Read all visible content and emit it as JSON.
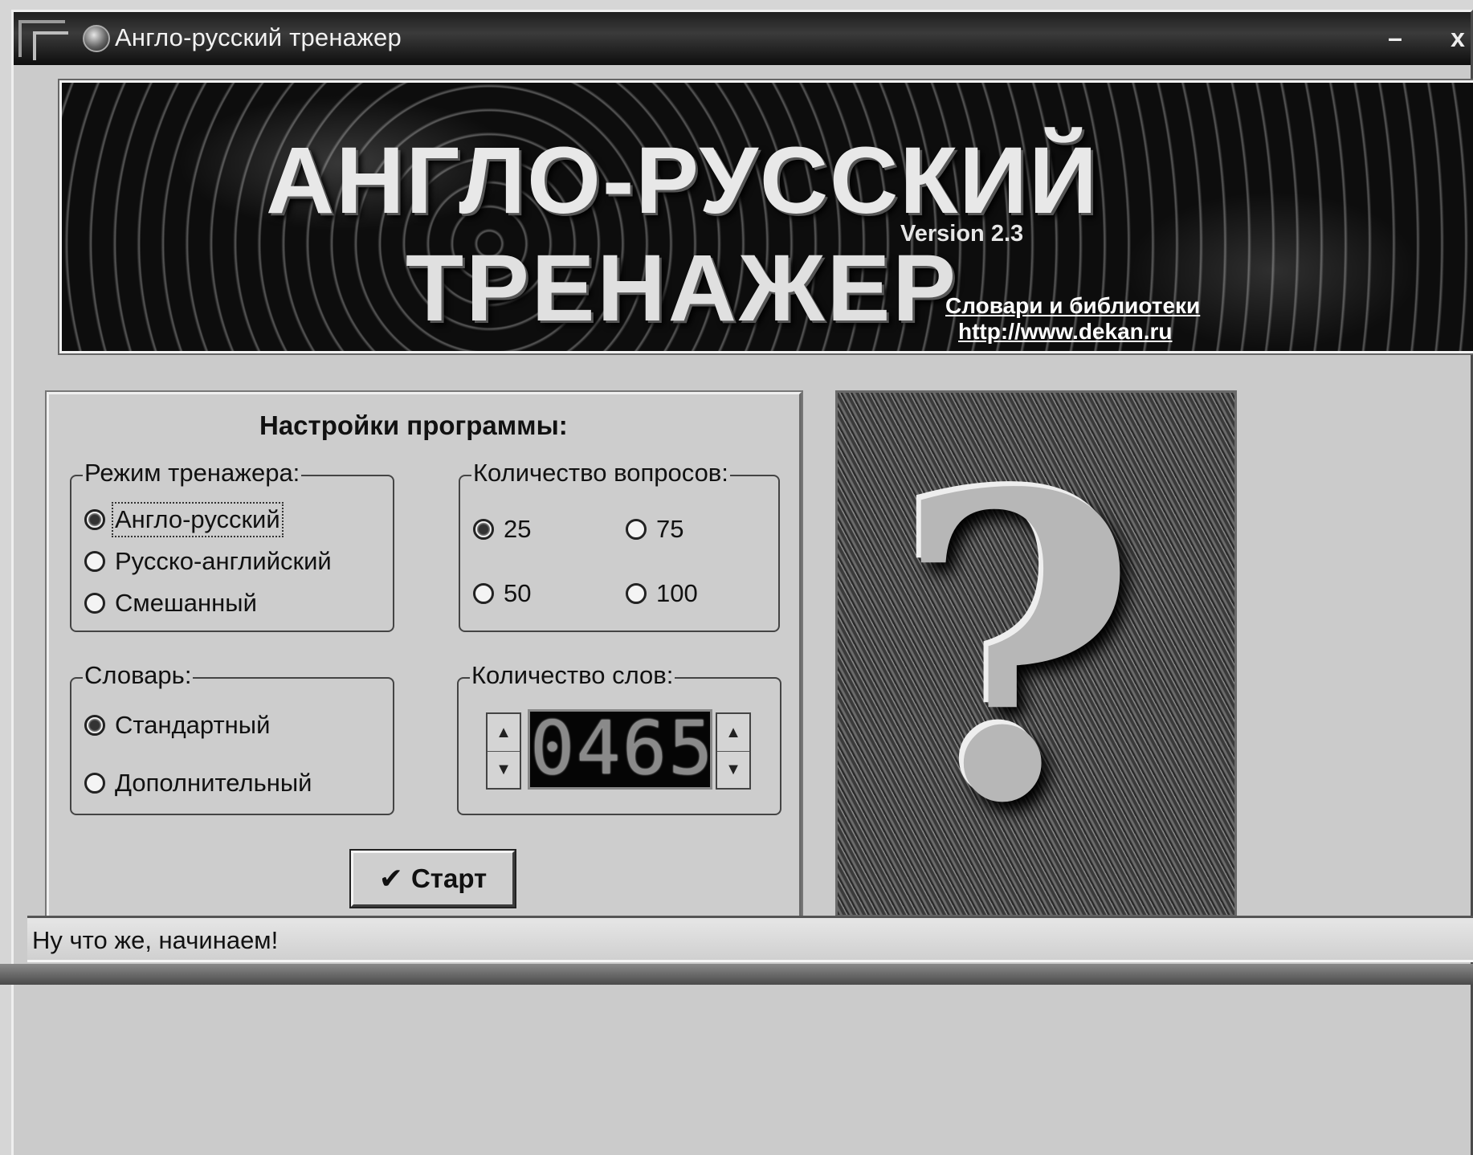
{
  "window": {
    "title": "Англо-русский тренажер",
    "minimize_label": "–",
    "close_label": "x"
  },
  "banner": {
    "line1": "АНГЛО-РУССКИЙ",
    "line2": "ТРЕНАЖЕР",
    "version": "Version 2.3",
    "link_text": "Словари и библиотеки",
    "link_url": "http://www.dekan.ru"
  },
  "settings": {
    "title": "Настройки программы:",
    "mode": {
      "caption": "Режим тренажера:",
      "options": [
        {
          "label": "Англо-русский",
          "selected": true
        },
        {
          "label": "Русско-английский",
          "selected": false
        },
        {
          "label": "Смешанный",
          "selected": false
        }
      ]
    },
    "questions": {
      "caption": "Количество вопросов:",
      "options": [
        {
          "label": "25",
          "selected": true
        },
        {
          "label": "75",
          "selected": false
        },
        {
          "label": "50",
          "selected": false
        },
        {
          "label": "100",
          "selected": false
        }
      ]
    },
    "dictionary": {
      "caption": "Словарь:",
      "options": [
        {
          "label": "Стандартный",
          "selected": true
        },
        {
          "label": "Дополнительный",
          "selected": false
        }
      ]
    },
    "word_count": {
      "caption": "Количество слов:",
      "value": "0465",
      "up_arrow": "▲",
      "down_arrow": "▼"
    },
    "start_button": {
      "icon": "check-icon",
      "check_glyph": "✔",
      "label": "Старт"
    }
  },
  "image": {
    "icon": "question-mark",
    "glyph": "?"
  },
  "status": {
    "text": "Ну что же, начинаем!"
  }
}
